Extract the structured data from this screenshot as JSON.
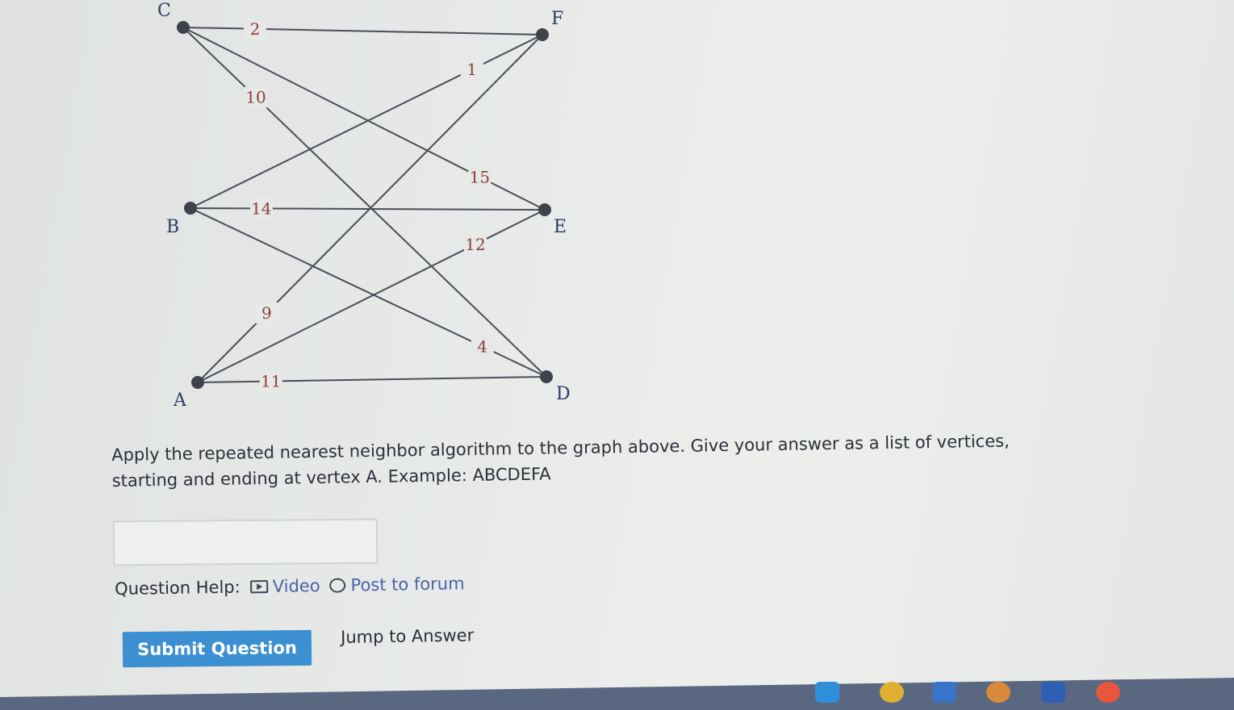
{
  "graph": {
    "vertices": [
      {
        "name": "C"
      },
      {
        "name": "F"
      },
      {
        "name": "B"
      },
      {
        "name": "E"
      },
      {
        "name": "A"
      },
      {
        "name": "D"
      }
    ],
    "edges": [
      {
        "from": "C",
        "to": "F",
        "weight": "2"
      },
      {
        "from": "B",
        "to": "F",
        "weight": "1"
      },
      {
        "from": "C",
        "to": "D",
        "weight": "10"
      },
      {
        "from": "C",
        "to": "E",
        "weight": "15"
      },
      {
        "from": "B",
        "to": "E",
        "weight": "14"
      },
      {
        "from": "A",
        "to": "E",
        "weight": "12"
      },
      {
        "from": "A",
        "to": "F",
        "weight": "9"
      },
      {
        "from": "B",
        "to": "D",
        "weight": "4"
      },
      {
        "from": "A",
        "to": "D",
        "weight": "11"
      }
    ]
  },
  "question": {
    "text": "Apply the repeated nearest neighbor algorithm to the graph above. Give your answer as a list of vertices, starting and ending at vertex A. Example: ABCDEFA"
  },
  "answer": {
    "value": ""
  },
  "help": {
    "label": "Question Help:",
    "video": "Video",
    "forum": "Post to forum"
  },
  "buttons": {
    "submit": "Submit Question",
    "jump": "Jump to Answer"
  },
  "colors": {
    "submit_bg": "#3c8fd0",
    "link": "#4b63a8",
    "weight_label": "#8a3f3c",
    "vertex_label": "#2c3a66"
  }
}
